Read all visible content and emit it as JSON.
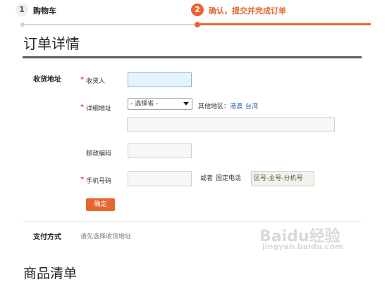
{
  "steps": [
    {
      "number": "1",
      "label": "购物车"
    },
    {
      "number": "2",
      "label": "确认，提交并完成订单"
    }
  ],
  "page_title": "订单详情",
  "address_section": {
    "title": "收货地址",
    "recipient_label": "收货人",
    "detail_label": "详细地址",
    "province_select": "- 选择省 -",
    "other_regions_label": "其他地区：",
    "hongkong_link": "港澳",
    "taiwan_link": "台湾",
    "postcode_label": "邮政编码",
    "phone_label": "手机号码",
    "or_label": "或者",
    "landline_label": "固定电话",
    "landline_placeholder": "区号-主号-分机号",
    "confirm_button": "确定"
  },
  "payment_section": {
    "title": "支付方式",
    "hint": "请先选择收货地址"
  },
  "product_section_title": "商品清单",
  "watermark": {
    "brand": "Baidu经验",
    "url": "jingyan.baidu.com"
  },
  "colors": {
    "accent": "#e8662f",
    "link": "#2a62b6",
    "required": "#d0021b"
  }
}
